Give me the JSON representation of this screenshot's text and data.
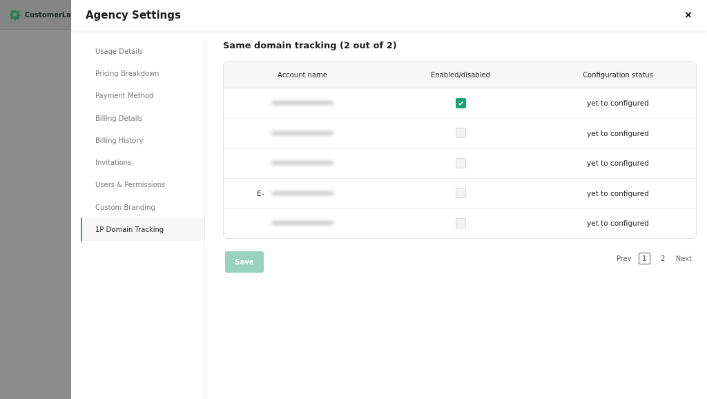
{
  "background_app": {
    "brand": "CustomerLa"
  },
  "dialog": {
    "title": "Agency Settings",
    "close": "×"
  },
  "sidebar": {
    "items": [
      {
        "label": "Usage Details",
        "selected": false
      },
      {
        "label": "Pricing Breakdown",
        "selected": false
      },
      {
        "label": "Payment Method",
        "selected": false
      },
      {
        "label": "Billing Details",
        "selected": false
      },
      {
        "label": "Billing History",
        "selected": false
      },
      {
        "label": "Invitations",
        "selected": false
      },
      {
        "label": "Users & Permissions",
        "selected": false
      },
      {
        "label": "Custom Branding",
        "selected": false
      },
      {
        "label": "1P Domain Tracking",
        "selected": true
      }
    ]
  },
  "section": {
    "title": "Same domain tracking (2 out of 2)"
  },
  "table": {
    "columns": [
      "Account name",
      "Enabled/disabled",
      "Configuration status"
    ],
    "rows": [
      {
        "redacted": true,
        "enabled": true,
        "status": "yet to configured"
      },
      {
        "redacted": true,
        "enabled": false,
        "status": "yet to configured"
      },
      {
        "redacted": true,
        "enabled": false,
        "status": "yet to configured"
      },
      {
        "account_name": "E-",
        "redacted": true,
        "enabled": false,
        "status": "yet to configured"
      },
      {
        "redacted": true,
        "enabled": false,
        "status": "yet to configured"
      }
    ]
  },
  "save_button": {
    "label": "Save",
    "disabled": true
  },
  "pagination": {
    "prev": "Prev",
    "next": "Next",
    "pages": [
      {
        "label": "1",
        "selected": true
      },
      {
        "label": "2",
        "selected": false
      }
    ]
  }
}
